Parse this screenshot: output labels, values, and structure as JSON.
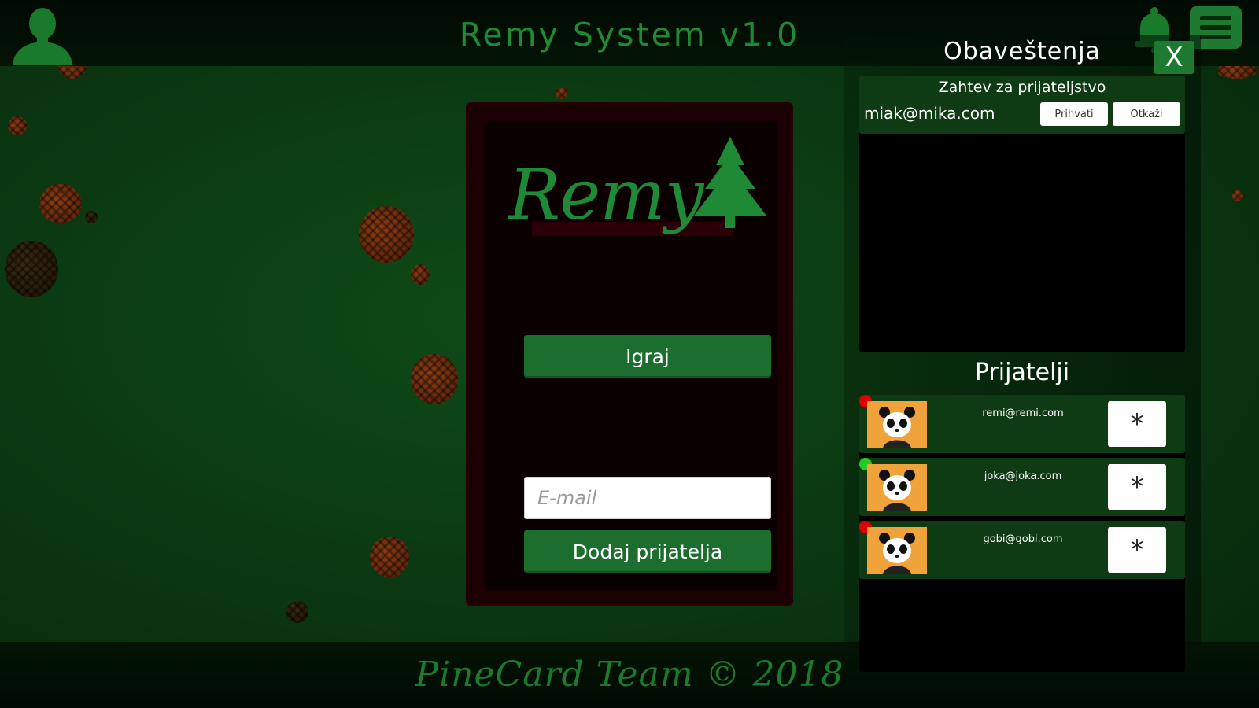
{
  "header": {
    "title": "Remy System v1.0",
    "profile_icon": "user-silhouette-icon",
    "notification_icon": "bell-icon",
    "menu_icon": "hamburger-menu-icon"
  },
  "main_card": {
    "logo_text": "Remy",
    "play_label": "Igraj",
    "email_placeholder": "E-mail",
    "add_friend_label": "Dodaj prijatelja"
  },
  "notifications": {
    "title": "Obaveštenja",
    "close_label": "X",
    "items": [
      {
        "heading": "Zahtev za prijateljstvo",
        "email": "miak@mika.com",
        "accept_label": "Prihvati",
        "decline_label": "Otkaži"
      }
    ]
  },
  "friends": {
    "title": "Prijatelji",
    "items": [
      {
        "email": "remi@remi.com",
        "status": "offline",
        "status_color": "#e00000",
        "options_label": "*"
      },
      {
        "email": "joka@joka.com",
        "status": "online",
        "status_color": "#22cc22",
        "options_label": "*"
      },
      {
        "email": "gobi@gobi.com",
        "status": "offline",
        "status_color": "#e00000",
        "options_label": "*"
      }
    ]
  },
  "footer": {
    "credit": "PineCard Team © 2018"
  },
  "colors": {
    "accent_green": "#1f7a31",
    "card_maroon": "#1b0003",
    "online": "#22cc22",
    "offline": "#e00000"
  }
}
